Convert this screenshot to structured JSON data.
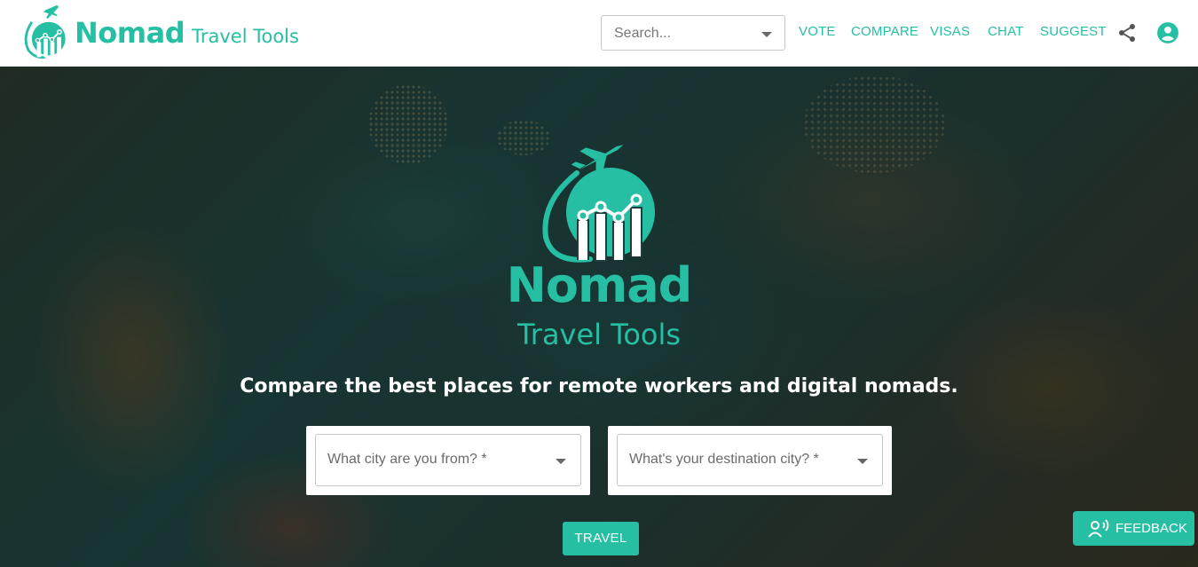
{
  "brand": {
    "name": "Nomad",
    "tagline": "Travel Tools"
  },
  "search": {
    "placeholder": "Search..."
  },
  "nav": [
    {
      "label": "VOTE"
    },
    {
      "label": "COMPARE"
    },
    {
      "label": "VISAS"
    },
    {
      "label": "CHAT"
    },
    {
      "label": "SUGGEST"
    }
  ],
  "header_icons": {
    "share": "share-icon",
    "account": "account-circle-icon"
  },
  "hero": {
    "logo_name": "Nomad",
    "logo_tagline": "Travel Tools",
    "headline": "Compare the best places for remote workers and digital nomads.",
    "origin_placeholder": "What city are you from? *",
    "destination_placeholder": "What's your destination city? *",
    "travel_label": "TRAVEL"
  },
  "feedback": {
    "label": "FEEDBACK",
    "icon": "voice-feedback-icon"
  },
  "colors": {
    "accent": "#26bfa3",
    "header_bg": "#ffffff",
    "text_white": "#ffffff"
  }
}
